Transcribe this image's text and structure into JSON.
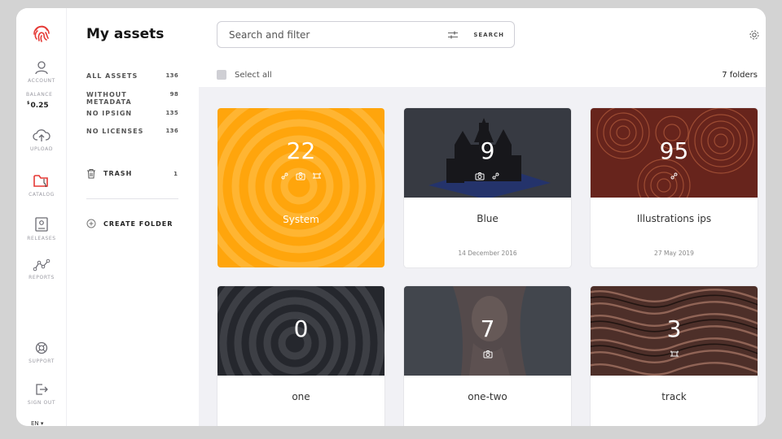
{
  "rail": {
    "items": [
      {
        "label": "ACCOUNT"
      },
      {
        "label": "UPLOAD"
      },
      {
        "label": "CATALOG"
      },
      {
        "label": "RELEASES"
      },
      {
        "label": "REPORTS"
      },
      {
        "label": "SUPPORT"
      },
      {
        "label": "SIGN OUT"
      }
    ],
    "balance_label": "BALANCE",
    "balance_currency": "$",
    "balance_value": "0.25",
    "language": "EN",
    "accent": "#e53935"
  },
  "nav": {
    "title": "My assets",
    "filters": [
      {
        "label": "ALL ASSETS",
        "count": "136"
      },
      {
        "label": "WITHOUT METADATA",
        "count": "98"
      },
      {
        "label": "NO IPSIGN",
        "count": "135"
      },
      {
        "label": "NO LICENSES",
        "count": "136"
      }
    ],
    "trash": {
      "label": "TRASH",
      "count": "1"
    },
    "create_folder": "CREATE FOLDER"
  },
  "toolbar": {
    "search_placeholder": "Search and filter",
    "search_button": "SEARCH",
    "select_all": "Select all",
    "folder_count": "7 folders"
  },
  "folders": [
    {
      "name": "System",
      "count": "22",
      "date": "",
      "icons": [
        "link-icon",
        "camera-icon",
        "film-icon"
      ],
      "theme": "orange"
    },
    {
      "name": "Blue",
      "count": "9",
      "date": "14 December 2016",
      "icons": [
        "camera-icon",
        "link-icon"
      ],
      "theme": "castle"
    },
    {
      "name": "Illustrations ips",
      "count": "95",
      "date": "27 May 2019",
      "icons": [
        "link-icon"
      ],
      "theme": "swirl"
    },
    {
      "name": "one",
      "count": "0",
      "date": "",
      "icons": [],
      "theme": "dark"
    },
    {
      "name": "one-two",
      "count": "7",
      "date": "",
      "icons": [
        "camera-icon"
      ],
      "theme": "portrait"
    },
    {
      "name": "track",
      "count": "3",
      "date": "",
      "icons": [
        "film-icon"
      ],
      "theme": "waves"
    }
  ],
  "colors": {
    "orange": "#ffa50c",
    "background": "#f1f1f5"
  }
}
